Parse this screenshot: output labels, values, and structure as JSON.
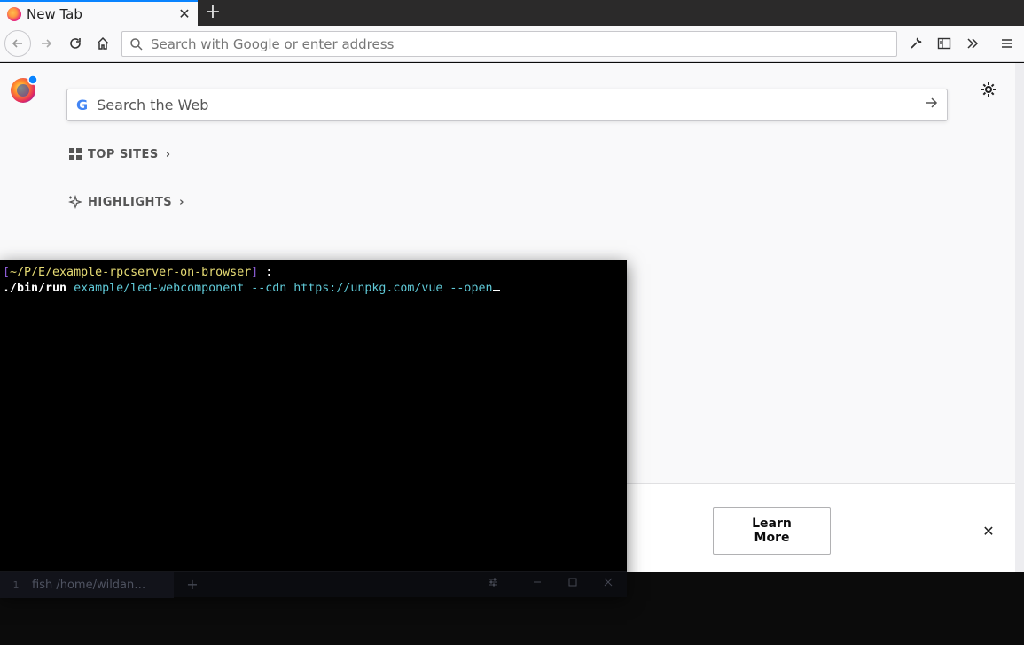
{
  "browser": {
    "tab": {
      "title": "New Tab",
      "close": "✕"
    },
    "new_tab": "+",
    "urlbar": {
      "placeholder": "Search with Google or enter address"
    }
  },
  "newtab_page": {
    "search": {
      "placeholder": "Search the Web"
    },
    "sections": [
      {
        "label": "TOP SITES"
      },
      {
        "label": "HIGHLIGHTS"
      }
    ],
    "snippet": {
      "button": "Learn More",
      "close": "✕"
    }
  },
  "terminal": {
    "prompt_open": "[",
    "cwd": "~/P/E/example-rpcserver-on-browser",
    "prompt_close": "]",
    "prompt_suffix": " :",
    "command": "./bin/run",
    "args1": "example/led-webcomponent",
    "flag1": "--cdn",
    "url": "https://unpkg.com/vue",
    "flag2": "--open",
    "tab": {
      "number": "1",
      "title": "fish /home/wildan…",
      "add": "+"
    }
  },
  "colors": {
    "accent": "#0a84ff",
    "terminal_bg": "#000000",
    "cwd": "#e6db74",
    "args": "#5fc8d6"
  }
}
